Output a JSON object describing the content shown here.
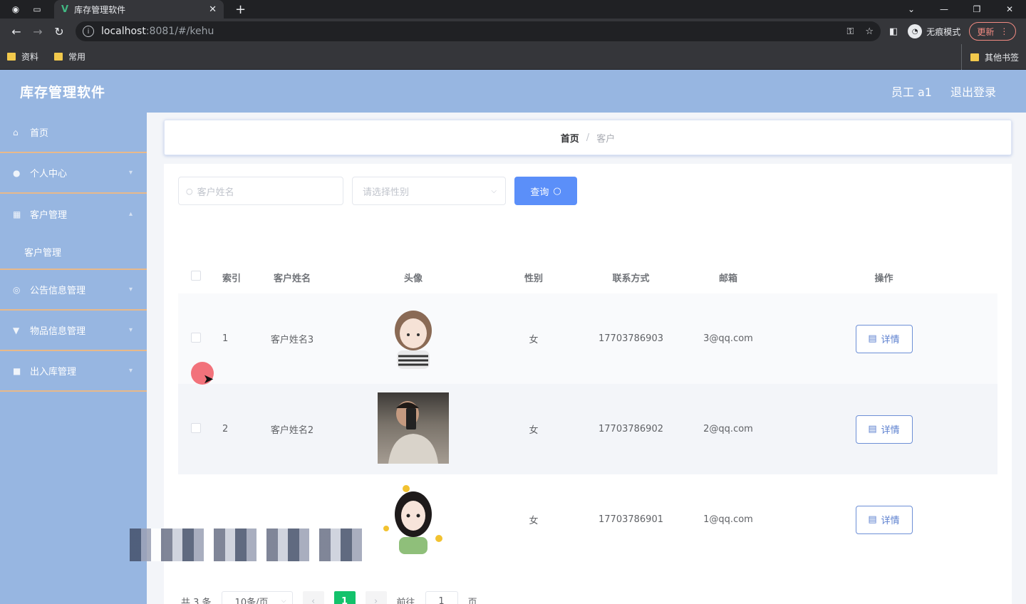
{
  "browser": {
    "tab_title": "库存管理软件",
    "url_host": "localhost",
    "url_path": ":8081/#/kehu",
    "incognito_label": "无痕模式",
    "update_label": "更新",
    "bookmarks": [
      "资料",
      "常用"
    ],
    "other_bookmarks": "其他书签"
  },
  "header": {
    "title": "库存管理软件",
    "user": "员工 a1",
    "logout": "退出登录"
  },
  "sidebar": {
    "items": [
      {
        "label": "首页",
        "icon": "home-icon"
      },
      {
        "label": "个人中心",
        "icon": "user-icon"
      },
      {
        "label": "客户管理",
        "icon": "grid-icon"
      },
      {
        "label": "客户管理",
        "icon": ""
      },
      {
        "label": "公告信息管理",
        "icon": "notice-icon"
      },
      {
        "label": "物品信息管理",
        "icon": "goods-icon"
      },
      {
        "label": "出入库管理",
        "icon": "stock-icon"
      }
    ]
  },
  "breadcrumb": {
    "home": "首页",
    "separator": "/",
    "current": "客户"
  },
  "search": {
    "name_placeholder": "客户姓名",
    "gender_placeholder": "请选择性别",
    "query_label": "查询"
  },
  "table": {
    "columns": [
      "索引",
      "客户姓名",
      "头像",
      "性别",
      "联系方式",
      "邮箱",
      "操作"
    ],
    "rows": [
      {
        "index": "1",
        "name": "客户姓名3",
        "gender": "女",
        "phone": "17703786903",
        "email": "3@qq.com",
        "action": "详情"
      },
      {
        "index": "2",
        "name": "客户姓名2",
        "gender": "女",
        "phone": "17703786902",
        "email": "2@qq.com",
        "action": "详情"
      },
      {
        "index": "",
        "name": "",
        "gender": "女",
        "phone": "17703786901",
        "email": "1@qq.com",
        "action": "详情"
      }
    ]
  },
  "pager": {
    "total": "共 3 条",
    "page_size": "10条/页",
    "current_page": "1",
    "goto_label": "前往",
    "goto_value": "1",
    "page_suffix": "页"
  },
  "colors": {
    "header_bg": "#97b6e1",
    "sidebar_divider": "#e8b98a",
    "query_button": "#5b8ff9",
    "current_page": "#13c26b"
  }
}
